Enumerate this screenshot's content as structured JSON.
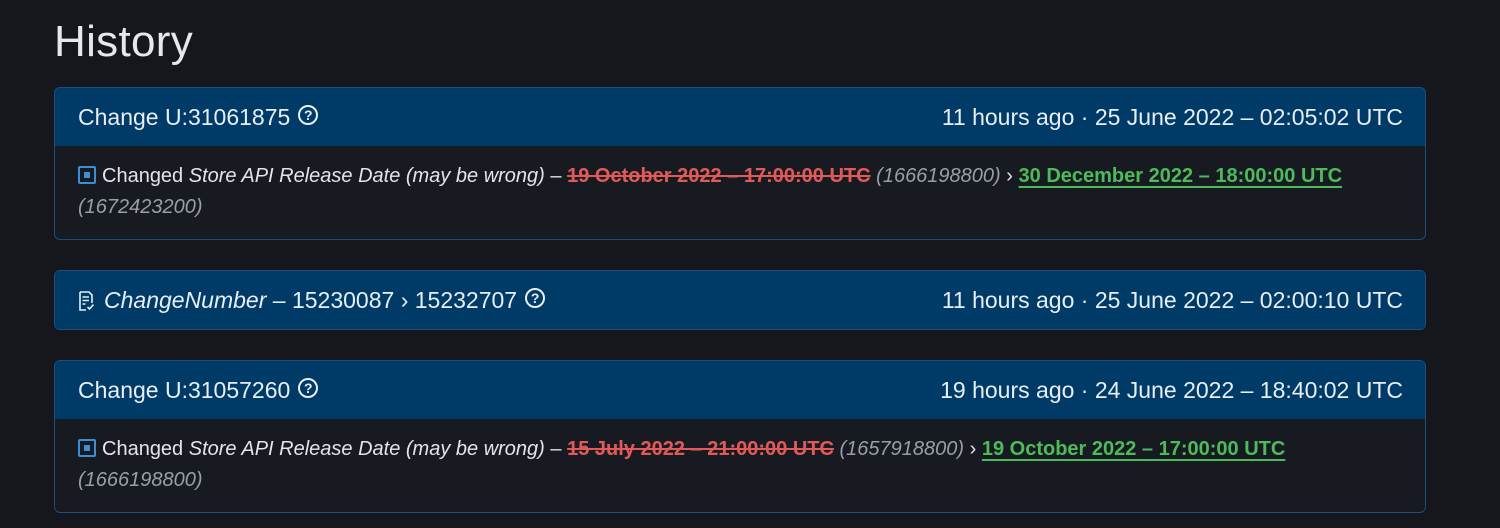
{
  "page": {
    "title": "History"
  },
  "entries": [
    {
      "change_label": "Change U:31061875",
      "help_glyph": "?",
      "time": "11 hours ago · 25 June 2022 – 02:05:02 UTC",
      "body": {
        "prefix": "Changed",
        "field": "Store API Release Date (may be wrong)",
        "dash": "–",
        "old_value": "19 October 2022 – 17:00:00 UTC",
        "old_ts": "(1666198800)",
        "arrow": "›",
        "new_value": "30 December 2022 – 18:00:00 UTC",
        "new_ts": "(1672423200)"
      }
    },
    {
      "field": "ChangeNumber",
      "dash": "–",
      "from": "15230087",
      "arrow": "›",
      "to": "15232707",
      "help_glyph": "?",
      "time": "11 hours ago · 25 June 2022 – 02:00:10 UTC"
    },
    {
      "change_label": "Change U:31057260",
      "help_glyph": "?",
      "time": "19 hours ago · 24 June 2022 – 18:40:02 UTC",
      "body": {
        "prefix": "Changed",
        "field": "Store API Release Date (may be wrong)",
        "dash": "–",
        "old_value": "15 July 2022 – 21:00:00 UTC",
        "old_ts": "(1657918800)",
        "arrow": "›",
        "new_value": "19 October 2022 – 17:00:00 UTC",
        "new_ts": "(1666198800)"
      }
    }
  ],
  "colors": {
    "background": "#16171d",
    "card_header": "#003a66",
    "old_value": "#e05a5a",
    "new_value": "#4cbb5a",
    "field_icon": "#3d8ed8"
  },
  "icons": {
    "help": "help-circle-icon",
    "field": "square-dot-icon",
    "change_number": "document-check-icon"
  }
}
